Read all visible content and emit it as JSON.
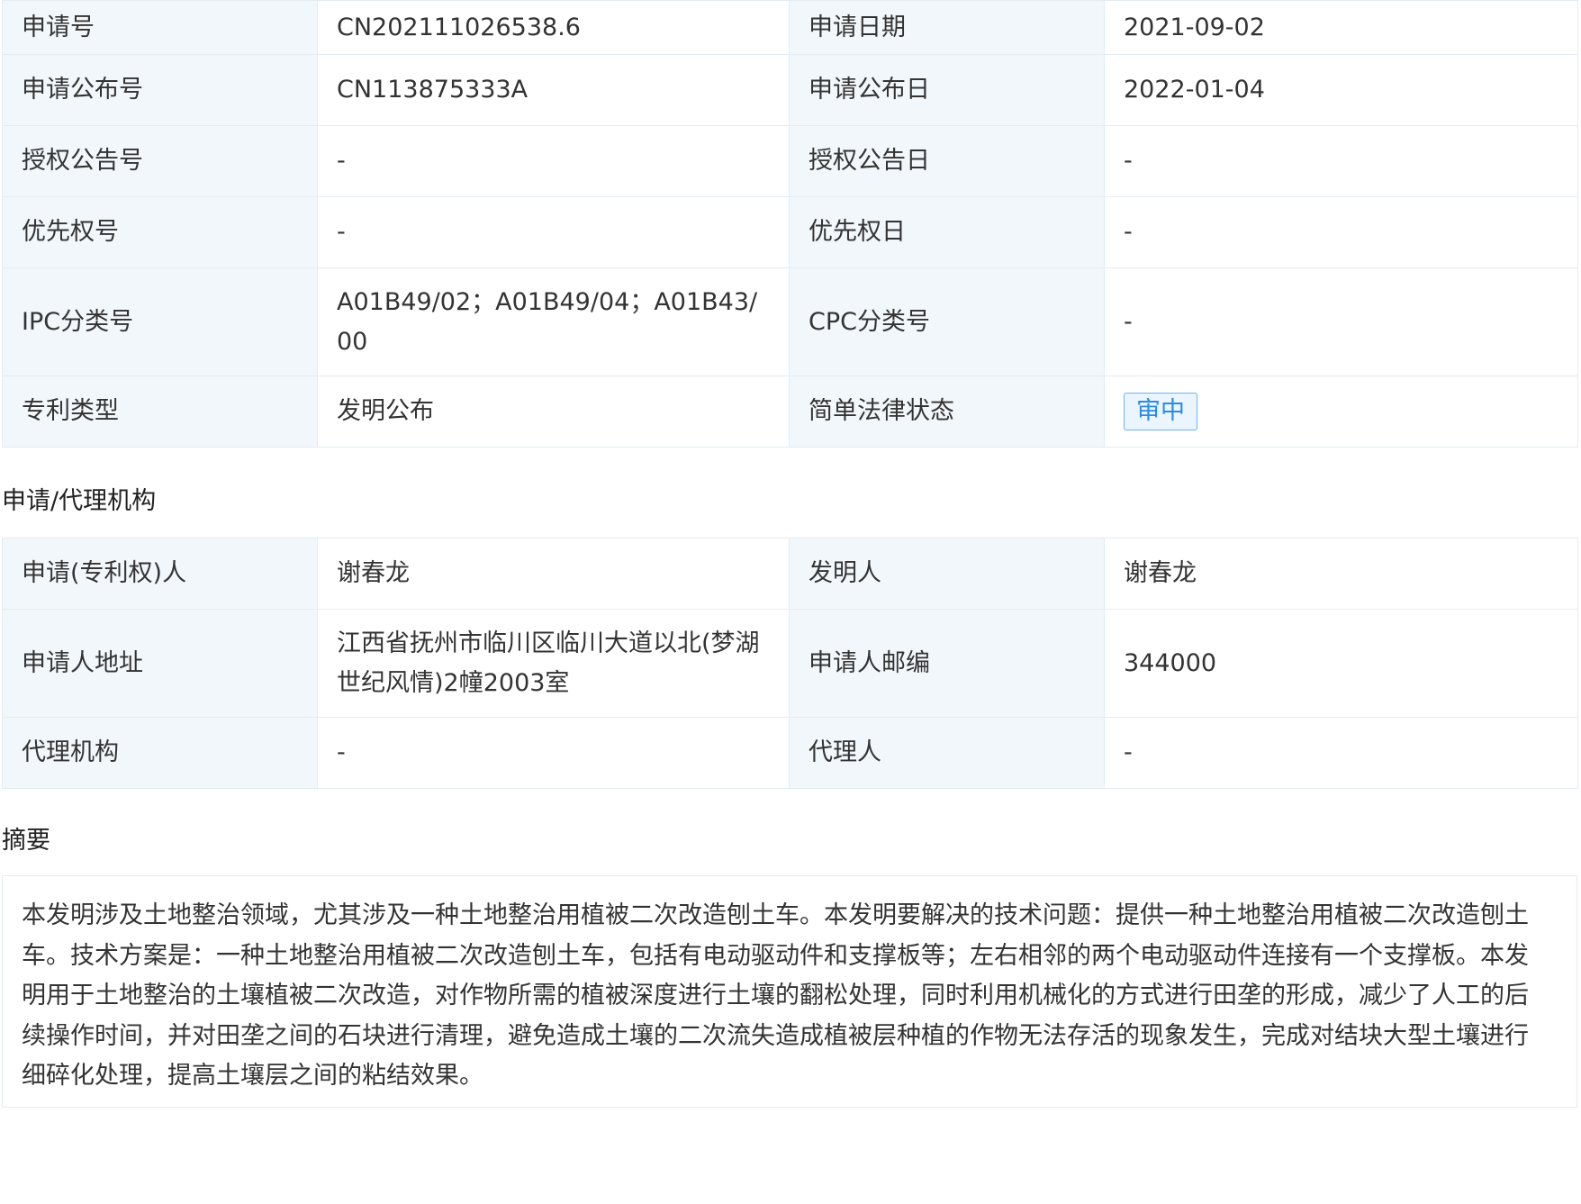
{
  "basic_info": {
    "rows": [
      {
        "l1": "申请号",
        "v1": "CN202111026538.6",
        "l2": "申请日期",
        "v2": "2021-09-02"
      },
      {
        "l1": "申请公布号",
        "v1": "CN113875333A",
        "l2": "申请公布日",
        "v2": "2022-01-04"
      },
      {
        "l1": "授权公告号",
        "v1": "-",
        "l2": "授权公告日",
        "v2": "-"
      },
      {
        "l1": "优先权号",
        "v1": "-",
        "l2": "优先权日",
        "v2": "-"
      },
      {
        "l1": "IPC分类号",
        "v1": "A01B49/02；A01B49/04；A01B43/00",
        "l2": "CPC分类号",
        "v2": "-"
      },
      {
        "l1": "专利类型",
        "v1": "发明公布",
        "l2": "简单法律状态",
        "v2": "审中"
      }
    ]
  },
  "agency_section": {
    "title": "申请/代理机构",
    "rows": [
      {
        "l1": "申请(专利权)人",
        "v1": "谢春龙",
        "l2": "发明人",
        "v2": "谢春龙"
      },
      {
        "l1": "申请人地址",
        "v1": "江西省抚州市临川区临川大道以北(梦湖世纪风情)2幢2003室",
        "l2": "申请人邮编",
        "v2": "344000"
      },
      {
        "l1": "代理机构",
        "v1": "-",
        "l2": "代理人",
        "v2": "-"
      }
    ]
  },
  "abstract_section": {
    "title": "摘要",
    "text": "本发明涉及土地整治领域，尤其涉及一种土地整治用植被二次改造刨土车。本发明要解决的技术问题：提供一种土地整治用植被二次改造刨土车。技术方案是：一种土地整治用植被二次改造刨土车，包括有电动驱动件和支撑板等；左右相邻的两个电动驱动件连接有一个支撑板。本发明用于土地整治的土壤植被二次改造，对作物所需的植被深度进行土壤的翻松处理，同时利用机械化的方式进行田垄的形成，减少了人工的后续操作时间，并对田垄之间的石块进行清理，避免造成土壤的二次流失造成植被层种植的作物无法存活的现象发生，完成对结块大型土壤进行细碎化处理，提高土壤层之间的粘结效果。"
  },
  "colors": {
    "label_bg": "#f2f7fb",
    "border": "#e4ecf3",
    "status_accent": "#2a8ce0"
  }
}
